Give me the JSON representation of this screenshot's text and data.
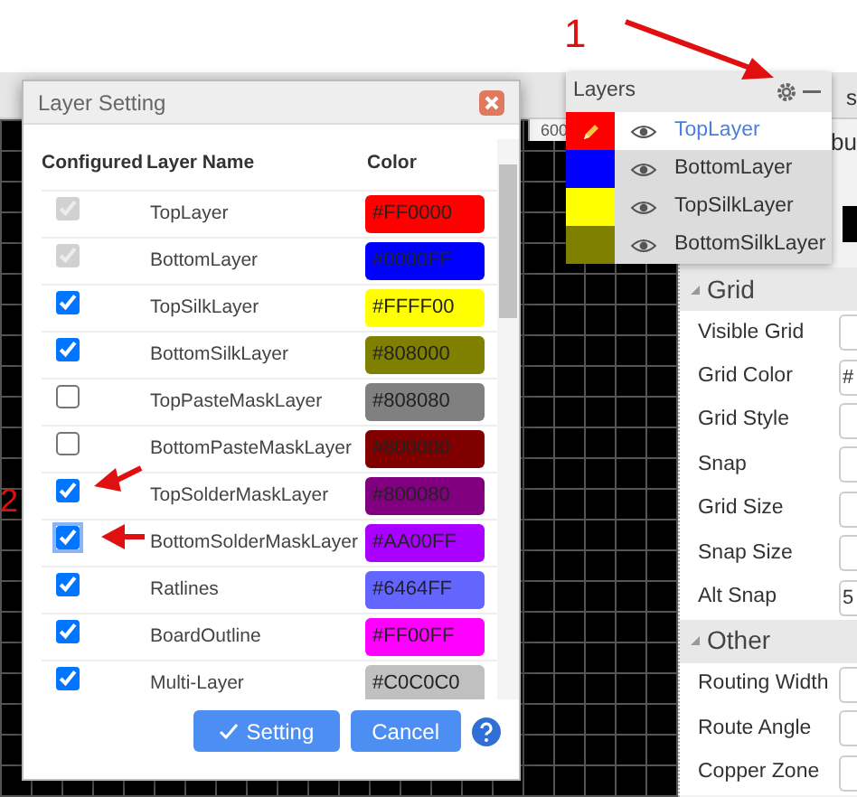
{
  "toolbar": {
    "tab_fragment": "s"
  },
  "ruler": {
    "label": "600"
  },
  "layer_setting": {
    "title": "Layer Setting",
    "columns": [
      "Configured",
      "Layer Name",
      "Color"
    ],
    "rows": [
      {
        "configured": true,
        "disabled": true,
        "focused": false,
        "name": "TopLayer",
        "hex": "#FF0000",
        "color": "#ff0000"
      },
      {
        "configured": true,
        "disabled": true,
        "focused": false,
        "name": "BottomLayer",
        "hex": "#0000FF",
        "color": "#0000ff"
      },
      {
        "configured": true,
        "disabled": false,
        "focused": false,
        "name": "TopSilkLayer",
        "hex": "#FFFF00",
        "color": "#ffff00"
      },
      {
        "configured": true,
        "disabled": false,
        "focused": false,
        "name": "BottomSilkLayer",
        "hex": "#808000",
        "color": "#808000"
      },
      {
        "configured": false,
        "disabled": false,
        "focused": false,
        "name": "TopPasteMaskLayer",
        "hex": "#808080",
        "color": "#808080"
      },
      {
        "configured": false,
        "disabled": false,
        "focused": false,
        "name": "BottomPasteMaskLayer",
        "hex": "#800000",
        "color": "#800000"
      },
      {
        "configured": true,
        "disabled": false,
        "focused": false,
        "name": "TopSolderMaskLayer",
        "hex": "#800080",
        "color": "#800080"
      },
      {
        "configured": true,
        "disabled": false,
        "focused": true,
        "name": "BottomSolderMaskLayer",
        "hex": "#AA00FF",
        "color": "#aa00ff"
      },
      {
        "configured": true,
        "disabled": false,
        "focused": false,
        "name": "Ratlines",
        "hex": "#6464FF",
        "color": "#6464ff"
      },
      {
        "configured": true,
        "disabled": false,
        "focused": false,
        "name": "BoardOutline",
        "hex": "#FF00FF",
        "color": "#ff00ff"
      },
      {
        "configured": true,
        "disabled": false,
        "focused": false,
        "name": "Multi-Layer",
        "hex": "#C0C0C0",
        "color": "#c0c0c0"
      }
    ],
    "buttons": [
      {
        "kind": "primary",
        "label": "Setting"
      },
      {
        "kind": "secondary",
        "label": "Cancel"
      }
    ]
  },
  "layers_panel": {
    "title": "Layers",
    "items": [
      {
        "name": "TopLayer",
        "color": "#ff0000",
        "selected": true
      },
      {
        "name": "BottomLayer",
        "color": "#0000ff",
        "selected": false
      },
      {
        "name": "TopSilkLayer",
        "color": "#ffff00",
        "selected": false
      },
      {
        "name": "BottomSilkLayer",
        "color": "#808000",
        "selected": false
      }
    ]
  },
  "properties": {
    "heading_fragment": "bu",
    "sections": [
      {
        "title": "Grid",
        "expanded": true,
        "properties": [
          {
            "label": "Visible Grid"
          },
          {
            "label": "Grid Color",
            "value": "#"
          },
          {
            "label": "Grid Style"
          },
          {
            "label": "Snap"
          },
          {
            "label": "Grid Size"
          },
          {
            "label": "Snap Size"
          },
          {
            "label": "Alt Snap",
            "value": "5"
          }
        ]
      },
      {
        "title": "Other",
        "expanded": true,
        "properties": [
          {
            "label": "Routing Width"
          },
          {
            "label": "Route Angle"
          },
          {
            "label": "Copper Zone"
          }
        ]
      }
    ]
  },
  "annotations": [
    {
      "number": "1"
    },
    {
      "number": "2"
    }
  ]
}
